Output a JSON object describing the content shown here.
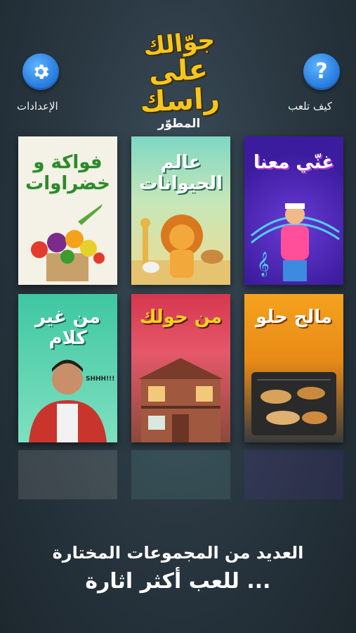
{
  "header": {
    "settings_label": "الإعدادات",
    "help_label": "كيف تلعب",
    "settings_icon": "gear-icon",
    "help_icon": "question-mark-icon",
    "accent_color": "#2b7fe0"
  },
  "logo": {
    "line1": "جوّالك",
    "line2": "على راسك",
    "subtitle": "المطوّر",
    "color": "#f5c61e"
  },
  "cards": [
    {
      "title": "فواكة و خضراوات"
    },
    {
      "title": "عالم الحيوانات"
    },
    {
      "title": "غنّي معنا"
    },
    {
      "title": "من غير كلام"
    },
    {
      "title": "من حولك"
    },
    {
      "title": "مالح حلو"
    }
  ],
  "tagline": {
    "line1": "العديد من المجموعات المختارة",
    "line2": "للعب أكثر اثارة ..."
  }
}
